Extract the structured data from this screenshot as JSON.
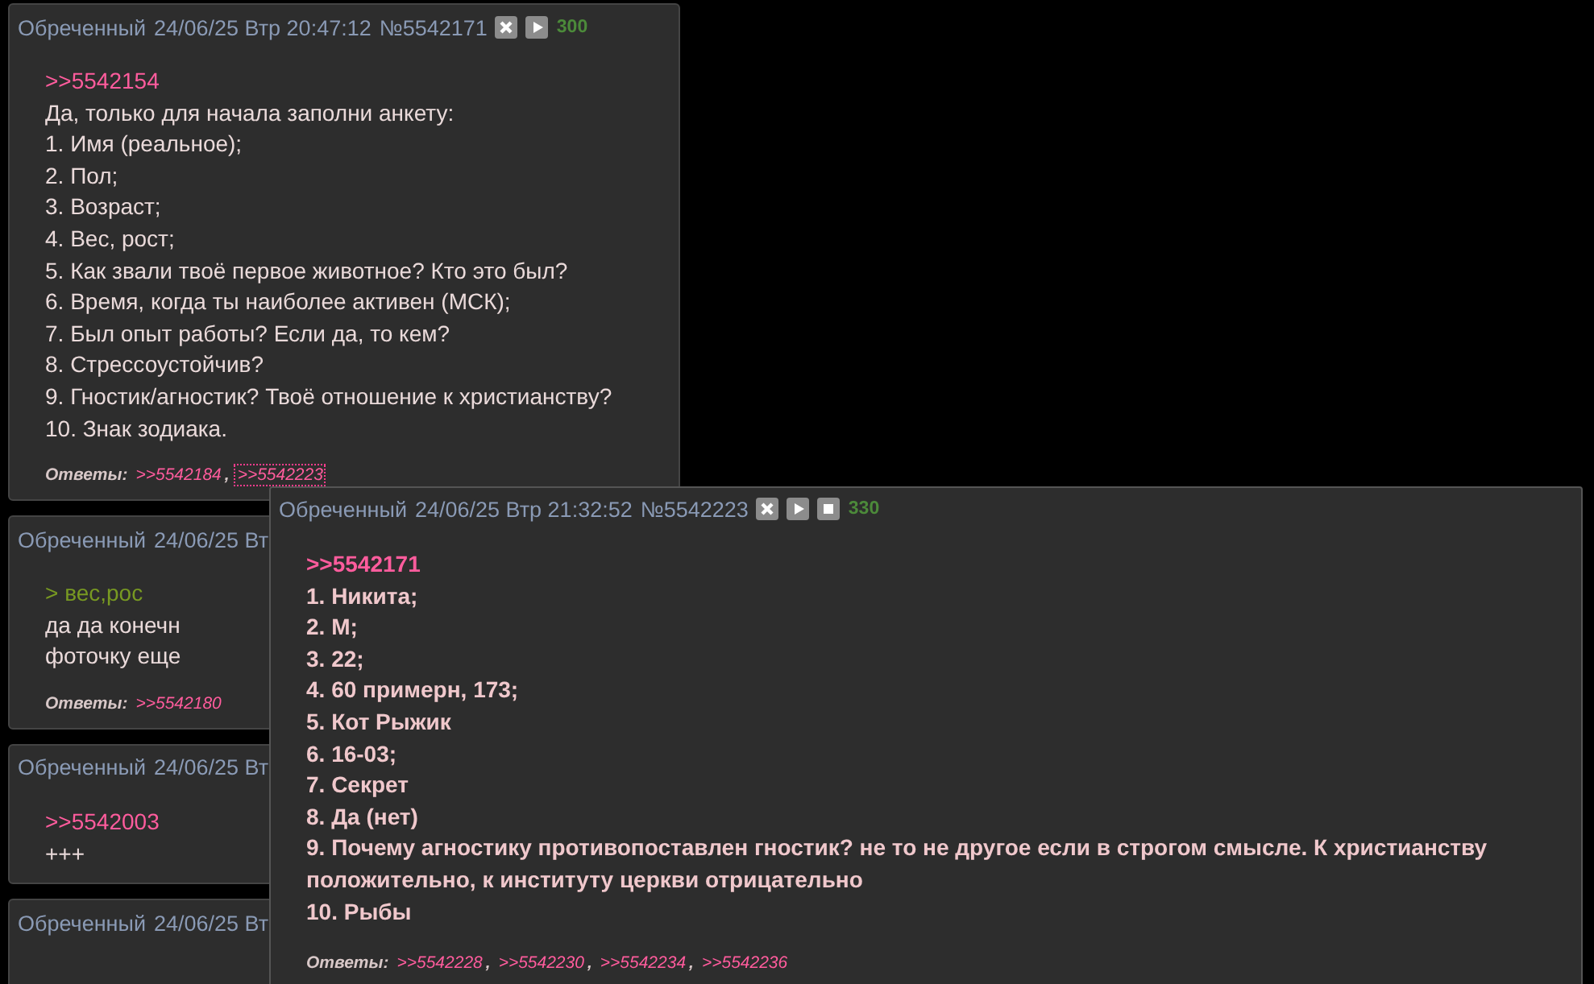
{
  "posts": [
    {
      "header": {
        "author": "Обреченный",
        "date": "24/06/25 Втр 20:47:12",
        "number": "№5542171",
        "buttons": [
          {
            "kind": "close"
          },
          {
            "kind": "play"
          }
        ],
        "score": "300"
      },
      "body": [
        {
          "kind": "link",
          "text": ">>5542154"
        },
        {
          "kind": "text",
          "text": "Да, только для начала заполни анкету:"
        },
        {
          "kind": "text",
          "text": "1. Имя (реальное);"
        },
        {
          "kind": "text",
          "text": "2. Пол;"
        },
        {
          "kind": "text",
          "text": "3. Возраст;"
        },
        {
          "kind": "text",
          "text": "4. Вес, рост;"
        },
        {
          "kind": "text",
          "text": "5. Как звали твоё первое животное? Кто это был?"
        },
        {
          "kind": "text",
          "text": "6. Время, когда ты наиболее активен (МСК);"
        },
        {
          "kind": "text",
          "text": "7. Был опыт работы? Если да, то кем?"
        },
        {
          "kind": "text",
          "text": "8. Стрессоустойчив?"
        },
        {
          "kind": "text",
          "text": "9. Гностик/агностик? Твоё отношение к христианству?"
        },
        {
          "kind": "text",
          "text": "10. Знак зодиака."
        }
      ],
      "replies": {
        "label": "Ответы:",
        "separator": ",",
        "links": [
          {
            "text": ">>5542184",
            "selected": false
          },
          {
            "text": ">>5542223",
            "selected": true
          }
        ]
      }
    },
    {
      "header": {
        "author": "Обреченный",
        "date": "24/06/25 Вт"
      },
      "body": [
        {
          "kind": "quote",
          "text": "> вес,рос"
        },
        {
          "kind": "text",
          "text": "да да конечн"
        },
        {
          "kind": "text",
          "text": "фоточку еще"
        }
      ],
      "replies": {
        "label": "Ответы:",
        "links": [
          {
            "text": ">>5542180",
            "selected": false
          }
        ]
      }
    },
    {
      "header": {
        "author": "Обреченный",
        "date": "24/06/25 Вт"
      },
      "body": [
        {
          "kind": "link",
          "text": ">>5542003"
        },
        {
          "kind": "text",
          "text": "+++"
        }
      ]
    },
    {
      "header": {
        "author": "Обреченный",
        "date": "24/06/25 Вт"
      }
    }
  ],
  "popup": {
    "header": {
      "author": "Обреченный",
      "date": "24/06/25 Втр 21:32:52",
      "number": "№5542223",
      "buttons": [
        {
          "kind": "close"
        },
        {
          "kind": "play"
        },
        {
          "kind": "stop"
        }
      ],
      "score": "330"
    },
    "body": [
      {
        "kind": "link",
        "text": ">>5542171"
      },
      {
        "kind": "text",
        "text": "1. Никита;"
      },
      {
        "kind": "text",
        "text": "2. М;"
      },
      {
        "kind": "text",
        "text": "3. 22;"
      },
      {
        "kind": "text",
        "text": "4. 60 примерн, 173;"
      },
      {
        "kind": "text",
        "text": "5. Кот Рыжик"
      },
      {
        "kind": "text",
        "text": "6. 16-03;"
      },
      {
        "kind": "text",
        "text": "7. Секрет"
      },
      {
        "kind": "text",
        "text": "8. Да (нет)"
      },
      {
        "kind": "text",
        "text": "9. Почему агностику противопоставлен гностик? не то не другое если в строгом смысле. К христианству положительно, к институту церкви отрицательно"
      },
      {
        "kind": "text",
        "text": "10. Рыбы"
      }
    ],
    "replies": {
      "label": "Ответы:",
      "separator": ",",
      "links": [
        {
          "text": ">>5542228",
          "selected": false
        },
        {
          "text": ">>5542230",
          "selected": false
        },
        {
          "text": ">>5542234",
          "selected": false
        },
        {
          "text": ">>5542236",
          "selected": false
        }
      ]
    }
  }
}
